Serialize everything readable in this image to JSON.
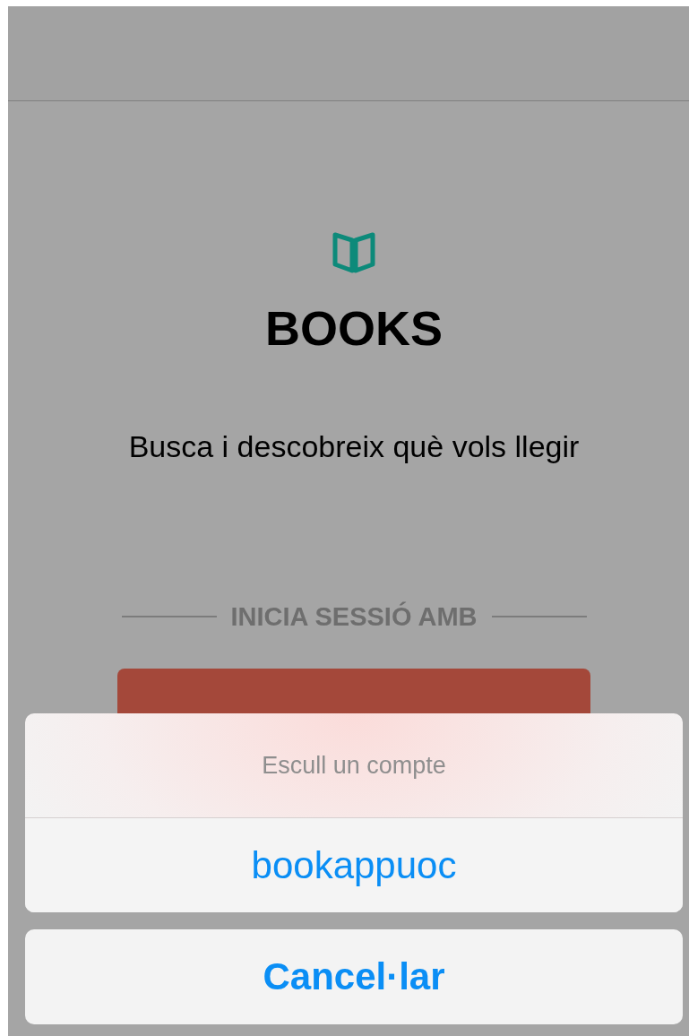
{
  "app": {
    "title": "BOOKS",
    "tagline": "Busca i descobreix què vols llegir",
    "divider_label": "INICIA SESSIÓ AMB"
  },
  "action_sheet": {
    "title": "Escull un compte",
    "options": [
      "bookappuoc"
    ],
    "cancel": "Cancel·lar"
  }
}
